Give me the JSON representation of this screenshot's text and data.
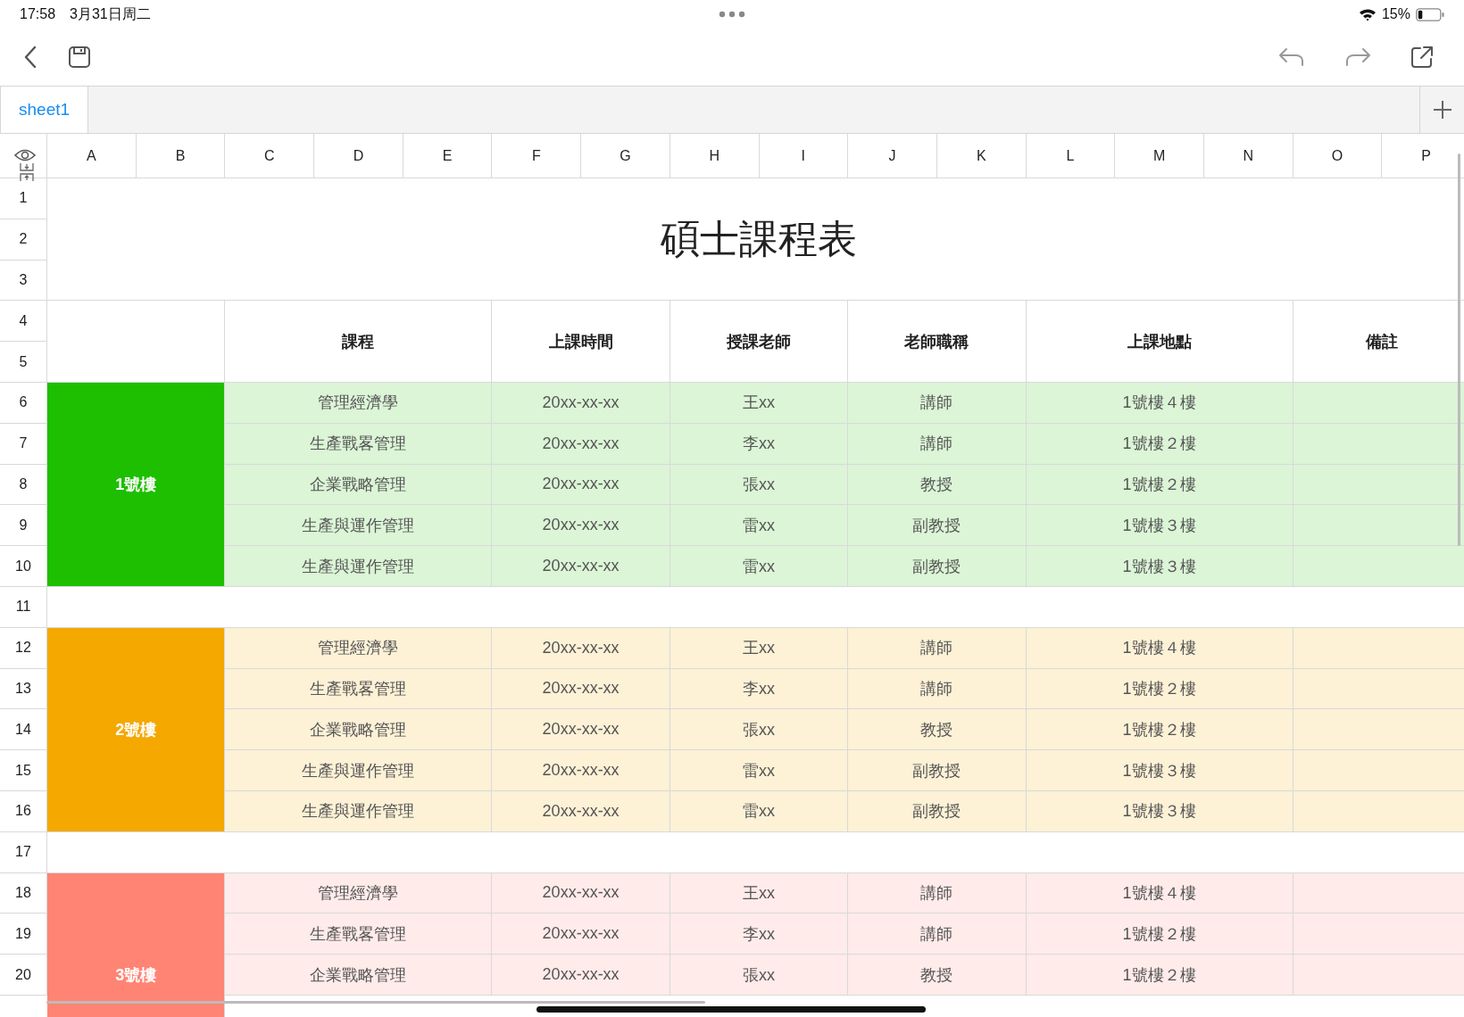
{
  "status_bar": {
    "time": "17:58",
    "date": "3月31日周二",
    "battery": "15%"
  },
  "sheet_tabs": [
    {
      "label": "sheet1",
      "selected": true
    }
  ],
  "columns": [
    "A",
    "B",
    "C",
    "D",
    "E",
    "F",
    "G",
    "H",
    "I",
    "J",
    "K",
    "L",
    "M",
    "N",
    "O",
    "P"
  ],
  "row_numbers": [
    "1",
    "2",
    "3",
    "4",
    "5",
    "6",
    "7",
    "8",
    "9",
    "10",
    "11",
    "12",
    "13",
    "14",
    "15",
    "16",
    "17",
    "18",
    "19",
    "20"
  ],
  "title": "碩士課程表",
  "headers": [
    "課程",
    "上課時間",
    "授課老師",
    "老師職稱",
    "上課地點",
    "備註"
  ],
  "groups": [
    {
      "label": "1號樓",
      "color": "#1dbf00",
      "rows": [
        [
          "管理經濟學",
          "20xx-xx-xx",
          "王xx",
          "講師",
          "1號樓４樓"
        ],
        [
          "生產戰畧管理",
          "20xx-xx-xx",
          "李xx",
          "講師",
          "1號樓２樓"
        ],
        [
          "企業戰略管理",
          "20xx-xx-xx",
          "張xx",
          "教授",
          "1號樓２樓"
        ],
        [
          "生產與運作管理",
          "20xx-xx-xx",
          "雷xx",
          "副教授",
          "1號樓３樓"
        ],
        [
          "生產與運作管理",
          "20xx-xx-xx",
          "雷xx",
          "副教授",
          "1號樓３樓"
        ]
      ]
    },
    {
      "label": "2號樓",
      "color": "#f4a800",
      "rows": [
        [
          "管理經濟學",
          "20xx-xx-xx",
          "王xx",
          "講師",
          "1號樓４樓"
        ],
        [
          "生產戰畧管理",
          "20xx-xx-xx",
          "李xx",
          "講師",
          "1號樓２樓"
        ],
        [
          "企業戰略管理",
          "20xx-xx-xx",
          "張xx",
          "教授",
          "1號樓２樓"
        ],
        [
          "生產與運作管理",
          "20xx-xx-xx",
          "雷xx",
          "副教授",
          "1號樓３樓"
        ],
        [
          "生產與運作管理",
          "20xx-xx-xx",
          "雷xx",
          "副教授",
          "1號樓３樓"
        ]
      ]
    },
    {
      "label": "3號樓",
      "color": "#ff8474",
      "rows": [
        [
          "管理經濟學",
          "20xx-xx-xx",
          "王xx",
          "講師",
          "1號樓４樓"
        ],
        [
          "生產戰畧管理",
          "20xx-xx-xx",
          "李xx",
          "講師",
          "1號樓２樓"
        ],
        [
          "企業戰略管理",
          "20xx-xx-xx",
          "張xx",
          "教授",
          "1號樓２樓"
        ]
      ]
    }
  ]
}
